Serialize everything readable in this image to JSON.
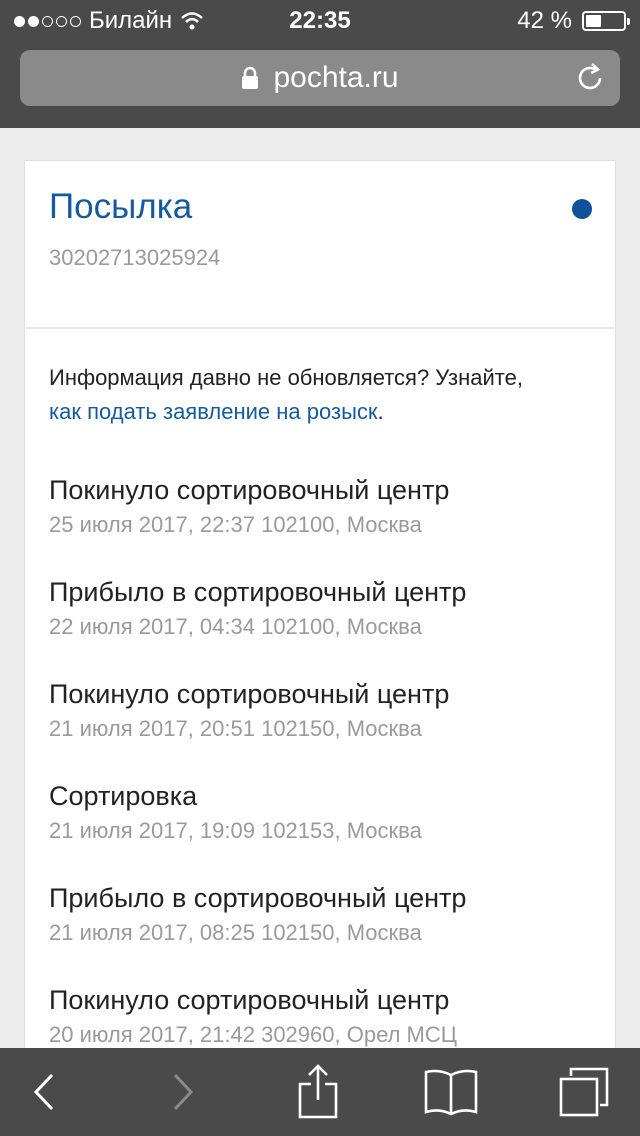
{
  "status_bar": {
    "carrier": "Билайн",
    "time": "22:35",
    "battery_text": "42 %",
    "battery_level": 0.42,
    "signal_bars_filled": 2,
    "signal_bars_total": 5
  },
  "browser": {
    "url": "pochta.ru"
  },
  "parcel": {
    "title": "Посылка",
    "tracking_number": "30202713025924",
    "status_color": "#11519c"
  },
  "notice": {
    "text": "Информация давно не обновляется? Узнайте,",
    "link_text": "как подать заявление на розыск",
    "suffix": "."
  },
  "events": [
    {
      "title": "Покинуло сортировочный центр",
      "meta": "25 июля 2017, 22:37 102100, Москва"
    },
    {
      "title": "Прибыло в сортировочный центр",
      "meta": "22 июля 2017, 04:34 102100, Москва"
    },
    {
      "title": "Покинуло сортировочный центр",
      "meta": "21 июля 2017, 20:51 102150, Москва"
    },
    {
      "title": "Сортировка",
      "meta": "21 июля 2017, 19:09 102153, Москва"
    },
    {
      "title": "Прибыло в сортировочный центр",
      "meta": "21 июля 2017, 08:25 102150, Москва"
    },
    {
      "title": "Покинуло сортировочный центр",
      "meta": "20 июля 2017, 21:42 302960, Орел МСЦ"
    }
  ],
  "toolbar": {
    "icons": [
      "back-icon",
      "forward-icon",
      "share-icon",
      "bookmarks-icon",
      "tabs-icon"
    ]
  }
}
